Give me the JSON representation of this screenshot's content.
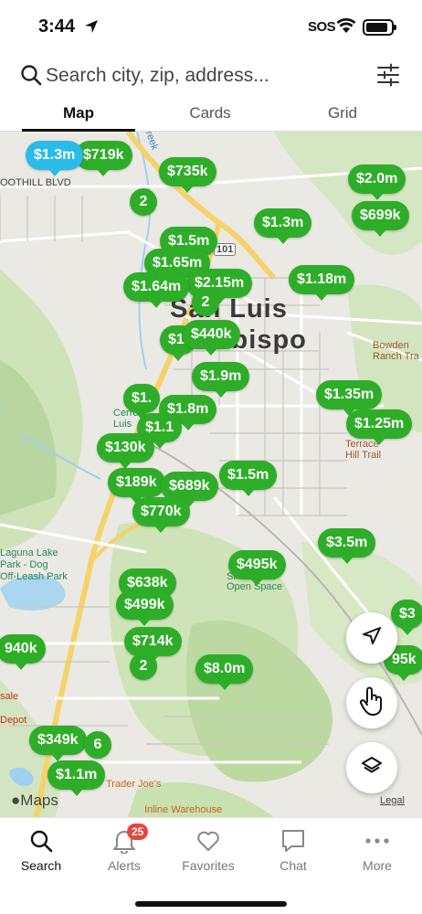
{
  "status": {
    "time": "3:44",
    "sos": "SOS"
  },
  "search": {
    "placeholder": "Search city, zip, address..."
  },
  "tabs": [
    {
      "label": "Map",
      "active": true
    },
    {
      "label": "Cards",
      "active": false
    },
    {
      "label": "Grid",
      "active": false
    }
  ],
  "map": {
    "places": {
      "foothill": "OOTHILL BLVD",
      "creek": "Creek",
      "slo1": "San Luis",
      "slo2": "Obispo",
      "bowden": "Bowden",
      "ranch": "Ranch Tra",
      "cerro": "Cerro",
      "luis": "Luis",
      "terrace": "Terrace",
      "hilltrail": "Hill Trail",
      "laguna1": "Laguna Lake",
      "laguna2": "Park - Dog",
      "laguna3": "Off-Leash Park",
      "sinsheimer": "Sinsheimer",
      "openspace": "Open Space",
      "sale": "sale",
      "depot": "Depot",
      "traderjoes": "Trader Joe's",
      "inline": "Inline Warehouse",
      "hwy": "101"
    },
    "pins": [
      {
        "label": "$719k",
        "color": "green"
      },
      {
        "label": "$1.3m",
        "color": "blue"
      },
      {
        "label": "$735k",
        "color": "green"
      },
      {
        "label": "2",
        "color": "green"
      },
      {
        "label": "$2.0m",
        "color": "green"
      },
      {
        "label": "$699k",
        "color": "green"
      },
      {
        "label": "$1.3m",
        "color": "green"
      },
      {
        "label": "$1.5m",
        "color": "green"
      },
      {
        "label": "$1.65m",
        "color": "green"
      },
      {
        "label": "$2.15m",
        "color": "green"
      },
      {
        "label": "$1.64m",
        "color": "green"
      },
      {
        "label": "2",
        "color": "green"
      },
      {
        "label": "$1.18m",
        "color": "green"
      },
      {
        "label": "$1.",
        "color": "green"
      },
      {
        "label": "$440k",
        "color": "green"
      },
      {
        "label": "$1.9m",
        "color": "green"
      },
      {
        "label": "$1.35m",
        "color": "green"
      },
      {
        "label": "$1.",
        "color": "green"
      },
      {
        "label": "$1.8m",
        "color": "green"
      },
      {
        "label": "$1.1",
        "color": "green"
      },
      {
        "label": "$1.25m",
        "color": "green"
      },
      {
        "label": "$130k",
        "color": "green"
      },
      {
        "label": "$1.5m",
        "color": "green"
      },
      {
        "label": "$189k",
        "color": "green"
      },
      {
        "label": "$689k",
        "color": "green"
      },
      {
        "label": "$770k",
        "color": "green"
      },
      {
        "label": "$3.5m",
        "color": "green"
      },
      {
        "label": "$495k",
        "color": "green"
      },
      {
        "label": "$638k",
        "color": "green"
      },
      {
        "label": "$499k",
        "color": "green"
      },
      {
        "label": "$714k",
        "color": "green"
      },
      {
        "label": "2",
        "color": "green"
      },
      {
        "label": "$8.0m",
        "color": "green"
      },
      {
        "label": "940k",
        "color": "green"
      },
      {
        "label": "$3",
        "color": "green"
      },
      {
        "label": "95k",
        "color": "green"
      },
      {
        "label": "$349k",
        "color": "green"
      },
      {
        "label": "6",
        "color": "green"
      },
      {
        "label": "$1.1m",
        "color": "green"
      }
    ],
    "attribution": "Maps",
    "legal": "Legal"
  },
  "nav": [
    {
      "label": "Search",
      "icon": "search-icon",
      "active": true
    },
    {
      "label": "Alerts",
      "icon": "bell-icon",
      "badge": "25"
    },
    {
      "label": "Favorites",
      "icon": "heart-icon"
    },
    {
      "label": "Chat",
      "icon": "chat-icon"
    },
    {
      "label": "More",
      "icon": "more-icon"
    }
  ],
  "colors": {
    "pin_green": "#2eae28",
    "pin_blue": "#2bbbe8",
    "badge_red": "#e8453c"
  }
}
